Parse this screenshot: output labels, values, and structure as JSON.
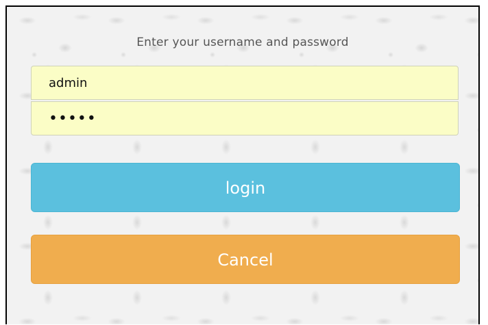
{
  "login_form": {
    "prompt": "Enter your username and password",
    "username": {
      "value": "admin"
    },
    "password": {
      "masked_value": "•••••"
    },
    "login_button": {
      "label": "login",
      "color": "#5bc0de"
    },
    "cancel_button": {
      "label": "Cancel",
      "color": "#f0ad4e"
    },
    "field_background_color": "#fbfdc6"
  }
}
